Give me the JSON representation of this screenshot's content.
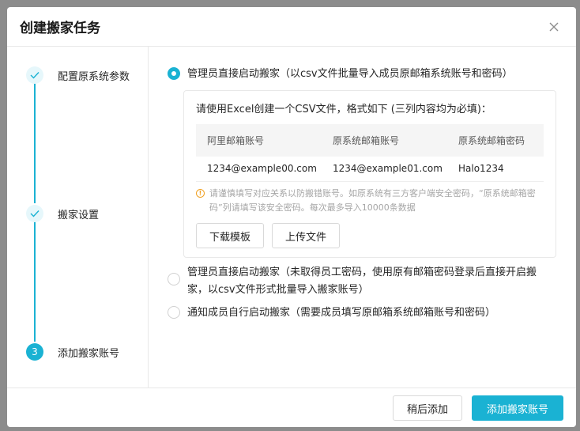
{
  "dialog": {
    "title": "创建搬家任务",
    "close_icon": "close-icon"
  },
  "steps": [
    {
      "label": "配置原系统参数",
      "status": "done"
    },
    {
      "label": "搬家设置",
      "status": "done"
    },
    {
      "label": "添加搬家账号",
      "status": "active",
      "number": "3"
    }
  ],
  "options": [
    {
      "label": "管理员直接启动搬家（以csv文件批量导入成员原邮箱系统账号和密码）",
      "checked": true
    },
    {
      "label": "管理员直接启动搬家（未取得员工密码，使用原有邮箱密码登录后直接开启搬家，以csv文件形式批量导入搬家账号）",
      "checked": false
    },
    {
      "label": "通知成员自行启动搬家（需要成员填写原邮箱系统邮箱账号和密码）",
      "checked": false
    }
  ],
  "panel": {
    "intro": "请使用Excel创建一个CSV文件，格式如下 (三列内容均为必填)：",
    "table_headers": [
      "阿里邮箱账号",
      "原系统邮箱账号",
      "原系统邮箱密码"
    ],
    "table_row": [
      "1234@example00.com",
      "1234@example01.com",
      "Halo1234"
    ],
    "tip": "请谨慎填写对应关系以防搬错账号。如原系统有三方客户端安全密码，“原系统邮箱密码”列请填写该安全密码。每次最多导入10000条数据",
    "download_template": "下载模板",
    "upload_file": "上传文件"
  },
  "footer": {
    "later_button": "稍后添加",
    "add_button": "添加搬家账号"
  },
  "colors": {
    "accent": "#1ab2d3",
    "warning": "#f0a020"
  }
}
